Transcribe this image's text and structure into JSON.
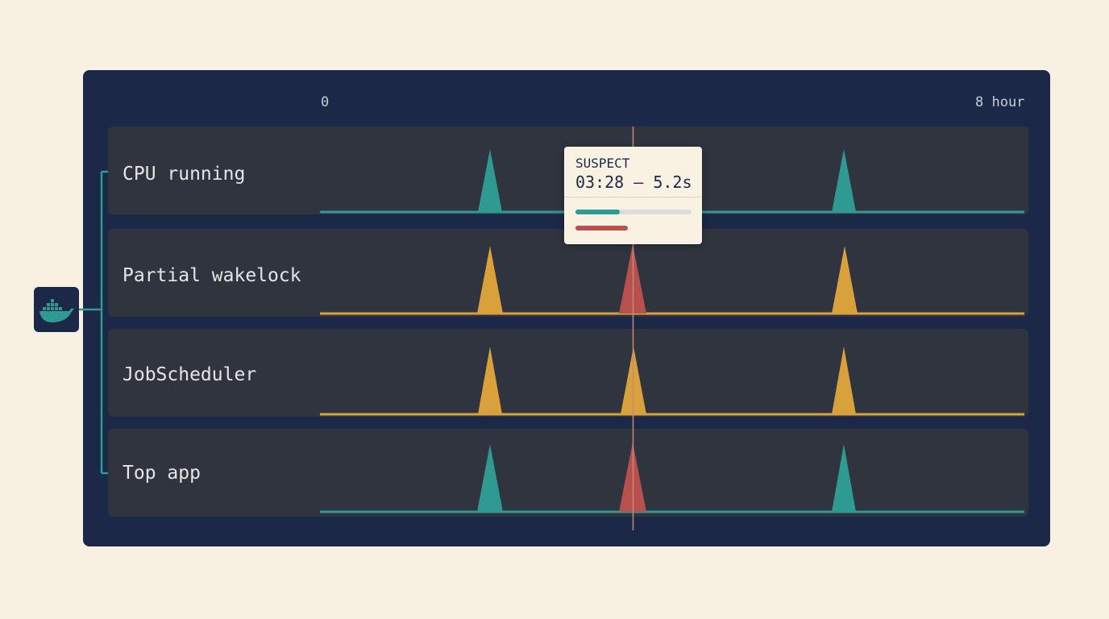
{
  "axis": {
    "start_label": "0",
    "end_label": "8 hour"
  },
  "tracks": [
    {
      "label": "CPU running",
      "color": "#2f9a92",
      "spikes": [
        "normal",
        "normal"
      ],
      "suspect_spike": false
    },
    {
      "label": "Partial wakelock",
      "color": "#d9a13b",
      "spikes": [
        "normal",
        "normal"
      ],
      "suspect_spike": true
    },
    {
      "label": "JobScheduler",
      "color": "#d9a13b",
      "spikes": [
        "normal",
        "normal"
      ],
      "suspect_spike": "amber"
    },
    {
      "label": "Top app",
      "color": "#2f9a92",
      "spikes": [
        "normal",
        "normal"
      ],
      "suspect_spike": true
    }
  ],
  "suspect_color": "#b8504e",
  "marker_color": "#c98679",
  "tooltip": {
    "title": "SUSPECT",
    "value": "03:28 – 5.2s",
    "progress": 0.38,
    "secondary_bar_fraction": 0.45
  },
  "app_icon": {
    "name": "docker-whale-icon",
    "color": "#2f9a92"
  }
}
